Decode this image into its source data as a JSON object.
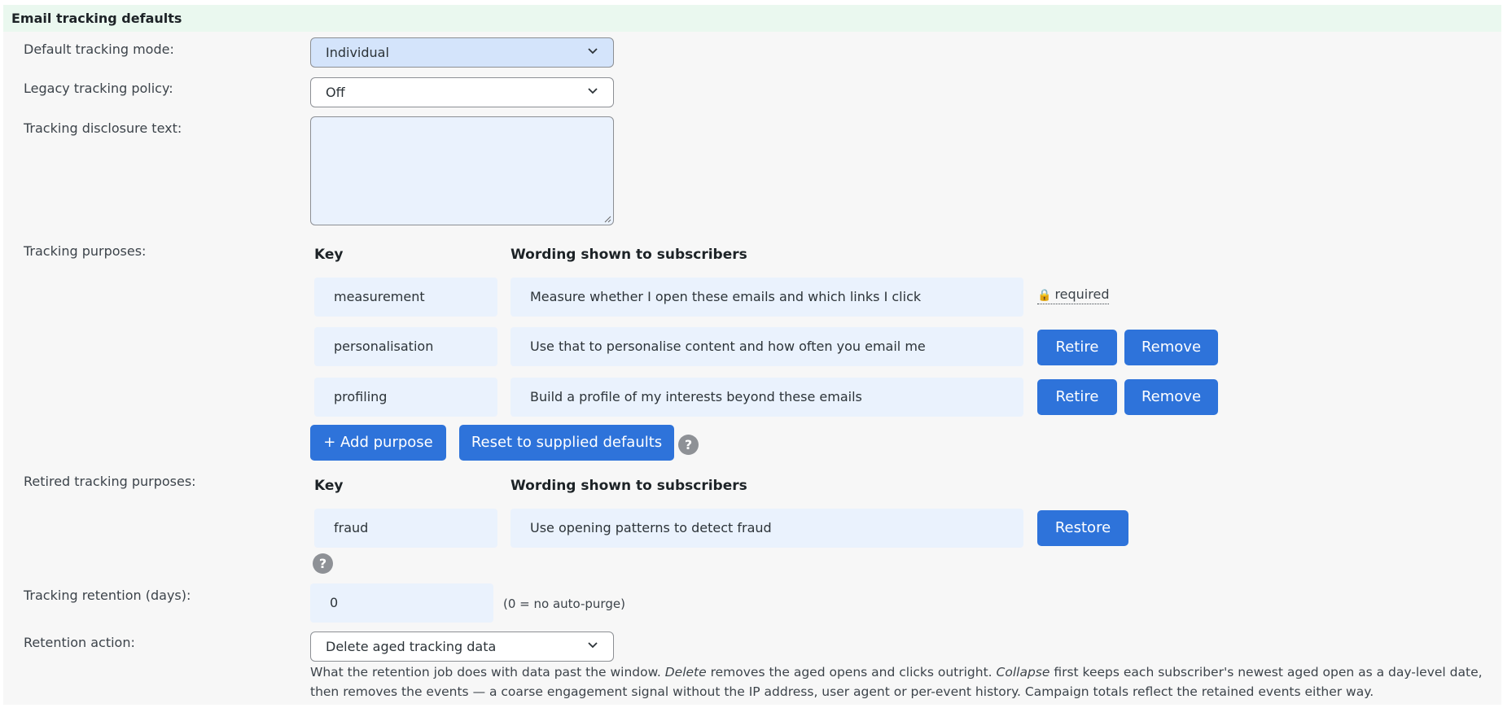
{
  "section": {
    "title": "Email tracking defaults"
  },
  "fields": {
    "tracking_mode": {
      "label": "Default tracking mode:",
      "value": "Individual"
    },
    "legacy_policy": {
      "label": "Legacy tracking policy:",
      "value": "Off"
    },
    "disclosure": {
      "label": "Tracking disclosure text:",
      "value": ""
    },
    "purposes_label": "Tracking purposes:",
    "retired_label": "Retired tracking purposes:",
    "retention_days": {
      "label": "Tracking retention (days):",
      "value": "0",
      "hint": "(0 = no auto-purge)"
    },
    "retention_action": {
      "label": "Retention action:",
      "value": "Delete aged tracking data"
    }
  },
  "purposes": {
    "headers": {
      "key": "Key",
      "wording": "Wording shown to subscribers"
    },
    "rows": [
      {
        "key": "measurement",
        "wording": "Measure whether I open these emails and which links I click",
        "status": "required",
        "status_icon": "lock-icon"
      },
      {
        "key": "personalisation",
        "wording": "Use that to personalise content and how often you email me"
      },
      {
        "key": "profiling",
        "wording": "Build a profile of my interests beyond these emails"
      }
    ],
    "retire_label": "Retire",
    "remove_label": "Remove",
    "add_label": "+ Add purpose",
    "reset_label": "Reset to supplied defaults",
    "help": "?"
  },
  "retired": {
    "headers": {
      "key": "Key",
      "wording": "Wording shown to subscribers"
    },
    "rows": [
      {
        "key": "fraud",
        "wording": "Use opening patterns to detect fraud"
      }
    ],
    "restore_label": "Restore",
    "help": "?"
  },
  "retention_description": {
    "p1": "What the retention job does with data past the window. ",
    "em1": "Delete",
    "p2": " removes the aged opens and clicks outright. ",
    "em2": "Collapse",
    "p3": " first keeps each subscriber's newest aged open as a day-level date, then removes the events — a coarse engagement signal without the IP address, user agent or per-event history. Campaign totals reflect the retained events either way."
  },
  "colors": {
    "accent": "#2e73da",
    "header_bg": "#eaf8ef",
    "field_bg": "#eaf2fd",
    "select_active_bg": "#d4e4fb"
  }
}
